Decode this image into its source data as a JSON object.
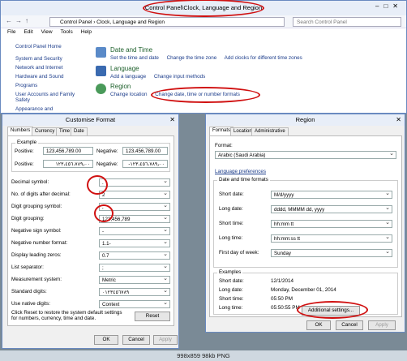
{
  "control_panel": {
    "title": "Control Panel\\Clock, Language and Region",
    "caption_buttons": "–□✕",
    "address": "Control Panel › Clock, Language and Region",
    "search_placeholder": "Search Control Panel",
    "menu": [
      "File",
      "Edit",
      "View",
      "Tools",
      "Help"
    ],
    "left_nav": [
      "Control Panel Home",
      "System and Security",
      "Network and Internet",
      "Hardware and Sound",
      "Programs",
      "User Accounts and Family Safety",
      "Appearance and"
    ],
    "categories": [
      {
        "title": "Date and Time",
        "links": [
          "Set the time and date",
          "Change the time zone",
          "Add clocks for different time zones"
        ]
      },
      {
        "title": "Language",
        "links": [
          "Add a language",
          "Change input methods"
        ]
      },
      {
        "title": "Region",
        "links": [
          "Change location",
          "Change date, time or number formats"
        ]
      }
    ]
  },
  "customise": {
    "title": "Customise Format",
    "tabs": [
      "Numbers",
      "Currency",
      "Time",
      "Date"
    ],
    "example_label": "Example",
    "positive_label": "Positive:",
    "positive_value": "123,456,789.00",
    "negative_label": "Negative:",
    "negative_value": "123,456,789.00",
    "positive_native": "١٢٣،٤٥٦،٧٨٩٫٠٠",
    "negative_native": "-١٢٣،٤٥٦،٧٨٩٫٠٠",
    "settings": [
      {
        "label": "Decimal symbol:",
        "value": "."
      },
      {
        "label": "No. of digits after decimal:",
        "value": "2"
      },
      {
        "label": "Digit grouping symbol:",
        "value": ","
      },
      {
        "label": "Digit grouping:",
        "value": "123,456,789"
      },
      {
        "label": "Negative sign symbol:",
        "value": "-"
      },
      {
        "label": "Negative number format:",
        "value": "1.1-"
      },
      {
        "label": "Display leading zeros:",
        "value": "0.7"
      },
      {
        "label": "List separator:",
        "value": ";"
      },
      {
        "label": "Measurement system:",
        "value": "Metric"
      },
      {
        "label": "Standard digits:",
        "value": "٠١٢٣٤٥٦٧٨٩"
      },
      {
        "label": "Use native digits:",
        "value": "Context"
      }
    ],
    "reset_note": "Click Reset to restore the system default settings for numbers, currency, time and date.",
    "reset": "Reset",
    "ok": "OK",
    "cancel": "Cancel",
    "apply": "Apply"
  },
  "region": {
    "title": "Region",
    "tabs": [
      "Formats",
      "Location",
      "Administrative"
    ],
    "format_label": "Format:",
    "format_value": "Arabic (Saudi Arabia)",
    "language_pref": "Language preferences",
    "dt_formats_label": "Date and time formats",
    "fields": [
      {
        "label": "Short date:",
        "value": "M/d/yyyy"
      },
      {
        "label": "Long date:",
        "value": "dddd, MMMM dd, yyyy"
      },
      {
        "label": "Short time:",
        "value": "hh:mm tt"
      },
      {
        "label": "Long time:",
        "value": "hh:mm:ss tt"
      },
      {
        "label": "First day of week:",
        "value": "Sunday"
      }
    ],
    "examples_label": "Examples",
    "examples": [
      {
        "label": "Short date:",
        "value": "12/1/2014"
      },
      {
        "label": "Long date:",
        "value": "Monday, December 01, 2014"
      },
      {
        "label": "Short time:",
        "value": "05:50 PM"
      },
      {
        "label": "Long time:",
        "value": "05:50:55 PM"
      }
    ],
    "additional": "Additional settings...",
    "ok": "OK",
    "cancel": "Cancel",
    "apply": "Apply"
  },
  "status_bar": "998x859  98kb  PNG",
  "colors": {
    "annotation": "#d01010",
    "link": "#1a3b8a",
    "heading": "#1c5f2a"
  }
}
